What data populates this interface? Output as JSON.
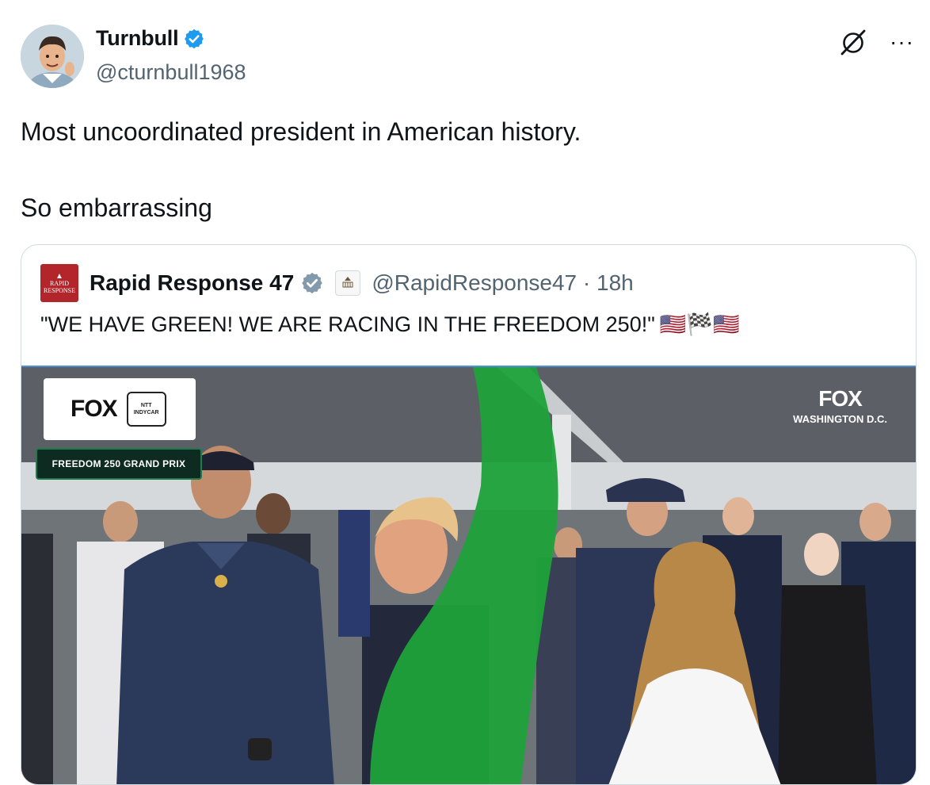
{
  "author": {
    "display_name": "Turnbull",
    "handle": "@cturnbull1968",
    "verified": true,
    "avatar_icon": "cartoon-avatar"
  },
  "header_icons": {
    "grok_icon": "slashed-circle-icon",
    "more_label": "···"
  },
  "tweet": {
    "line1": "Most uncoordinated president in American history.",
    "line2": "So embarrassing"
  },
  "quote": {
    "avatar_text_1": "RAPID",
    "avatar_text_2": "RESPONSE",
    "display_name": "Rapid Response 47",
    "verified_color": "#829aab",
    "handle_time": "@RapidResponse47 · 18h",
    "text": "\"WE HAVE GREEN! WE ARE RACING IN THE FREEDOM 250!\"",
    "emoji": "🇺🇸🏁🇺🇸"
  },
  "media": {
    "fox_logo": "FOX",
    "indycar_line1": "NTT",
    "indycar_line2": "INDYCAR",
    "grand_prix_label": "FREEDOM 250 GRAND PRIX",
    "corner_logo": "FOX",
    "corner_sub": "WASHINGTON D.C."
  },
  "colors": {
    "verified_blue": "#1d9bf0",
    "text_secondary": "#536471",
    "border": "#cfd9de",
    "flag_green": "#1fa23a"
  }
}
